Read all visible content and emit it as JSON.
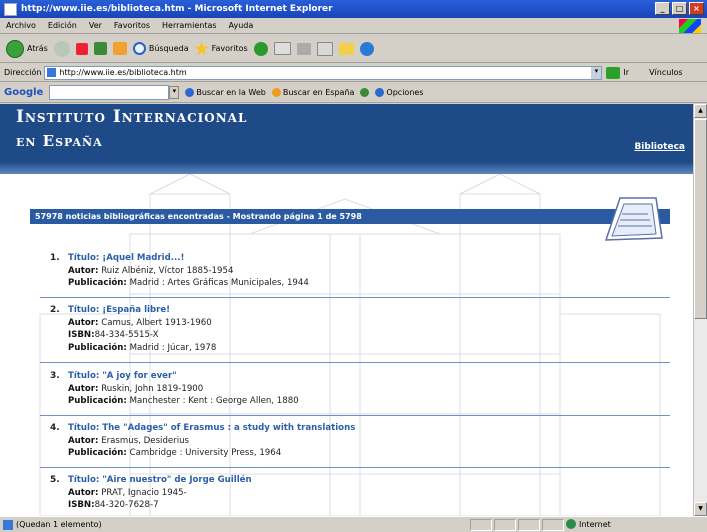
{
  "window": {
    "title": "http://www.iie.es/biblioteca.htm - Microsoft Internet Explorer",
    "buttons": [
      "_",
      "□",
      "×"
    ]
  },
  "menu": [
    "Archivo",
    "Edición",
    "Ver",
    "Favoritos",
    "Herramientas",
    "Ayuda"
  ],
  "toolbar": {
    "back_label": "Atrás",
    "search_label": "Búsqueda",
    "favorites_label": "Favoritos"
  },
  "address": {
    "label": "Dirección",
    "url": "http://www.iie.es/biblioteca.htm",
    "go_label": "Ir",
    "links_label": "Vínculos"
  },
  "google_bar": {
    "logo": "Google",
    "search_web": "Buscar en la Web",
    "search_spain": "Buscar en España",
    "options": "Opciones"
  },
  "site": {
    "title_line1": "Instituto Internacional",
    "title_line2": "en España",
    "section_link": "Biblioteca",
    "results_summary": "57978 noticias bibliográficas encontradas - Mostrando página 1 de 5798"
  },
  "records": [
    {
      "num": "1.",
      "title": "Título: ¡Aquel Madrid...!",
      "fields": [
        {
          "label": "Autor:",
          "value": "Ruiz Albéniz, Víctor 1885-1954"
        },
        {
          "label": "Publicación:",
          "value": "Madrid : Artes Gráficas Municipales, 1944"
        }
      ]
    },
    {
      "num": "2.",
      "title": "Título: ¡España libre!",
      "fields": [
        {
          "label": "Autor:",
          "value": "Camus, Albert 1913-1960"
        },
        {
          "label": "ISBN:",
          "value": "84-334-5515-X"
        },
        {
          "label": "Publicación:",
          "value": "Madrid : Júcar, 1978"
        }
      ]
    },
    {
      "num": "3.",
      "title": "Título: \"A joy for ever\"",
      "fields": [
        {
          "label": "Autor:",
          "value": "Ruskin, John 1819-1900"
        },
        {
          "label": "Publicación:",
          "value": "Manchester : Kent : George Allen, 1880"
        }
      ]
    },
    {
      "num": "4.",
      "title": "Título: The \"Adages\" of Erasmus : a study with translations",
      "fields": [
        {
          "label": "Autor:",
          "value": "Erasmus, Desiderius"
        },
        {
          "label": "Publicación:",
          "value": "Cambridge : University Press, 1964"
        }
      ]
    },
    {
      "num": "5.",
      "title": "Título: \"Aire nuestro\" de Jorge Guillén",
      "fields": [
        {
          "label": "Autor:",
          "value": "PRAT, Ignacio 1945-"
        },
        {
          "label": "ISBN:",
          "value": "84-320-7628-7"
        }
      ]
    }
  ],
  "status": {
    "text": "(Quedan 1 elemento)",
    "zone": "Internet"
  }
}
